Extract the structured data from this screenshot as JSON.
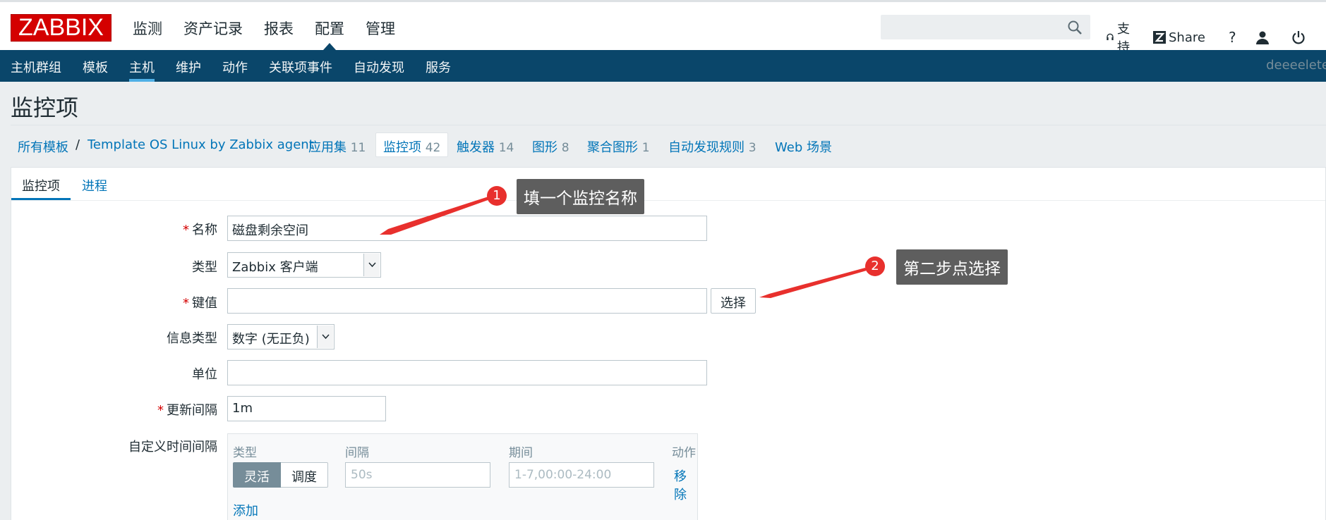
{
  "logo": "ZABBIX",
  "main_menu": [
    "监测",
    "资产记录",
    "报表",
    "配置",
    "管理"
  ],
  "main_menu_active": "配置",
  "top_links": {
    "support": "支持",
    "share": "Share",
    "help": "?"
  },
  "sub_nav": [
    "主机群组",
    "模板",
    "主机",
    "维护",
    "动作",
    "关联项事件",
    "自动发现",
    "服务"
  ],
  "sub_nav_active": "主机",
  "user": "deeeelete",
  "page_title": "监控项",
  "breadcrumb": {
    "all_templates": "所有模板",
    "separator": "/",
    "template": "Template OS Linux by Zabbix agent",
    "tabs": [
      {
        "label": "应用集",
        "count": "11"
      },
      {
        "label": "监控项",
        "count": "42"
      },
      {
        "label": "触发器",
        "count": "14"
      },
      {
        "label": "图形",
        "count": "8"
      },
      {
        "label": "聚合图形",
        "count": "1"
      },
      {
        "label": "自动发现规则",
        "count": "3"
      },
      {
        "label": "Web 场景",
        "count": ""
      }
    ]
  },
  "form_tabs": [
    "监控项",
    "进程"
  ],
  "form": {
    "required_mark": "*",
    "name_label": "名称",
    "name_value": "磁盘剩余空间",
    "type_label": "类型",
    "type_value": "Zabbix 客户端",
    "key_label": "键值",
    "key_value": "",
    "select_button": "选择",
    "info_type_label": "信息类型",
    "info_type_value": "数字 (无正负)",
    "units_label": "单位",
    "units_value": "",
    "interval_label": "更新间隔",
    "interval_value": "1m",
    "custom_intervals_label": "自定义时间间隔",
    "custom_intervals": {
      "col_type": "类型",
      "col_interval": "间隔",
      "col_period": "期间",
      "col_action": "动作",
      "flexible": "灵活",
      "scheduling": "调度",
      "interval_placeholder": "50s",
      "period_placeholder": "1-7,00:00-24:00",
      "remove": "移除",
      "add": "添加"
    }
  },
  "annotations": [
    {
      "number": "1",
      "text": "填一个监控名称"
    },
    {
      "number": "2",
      "text": "第二步点选择"
    }
  ],
  "colors": {
    "header": "#0a466a",
    "accent": "#0275b8",
    "logo": "#d40000",
    "annotation": "#e8302d"
  }
}
